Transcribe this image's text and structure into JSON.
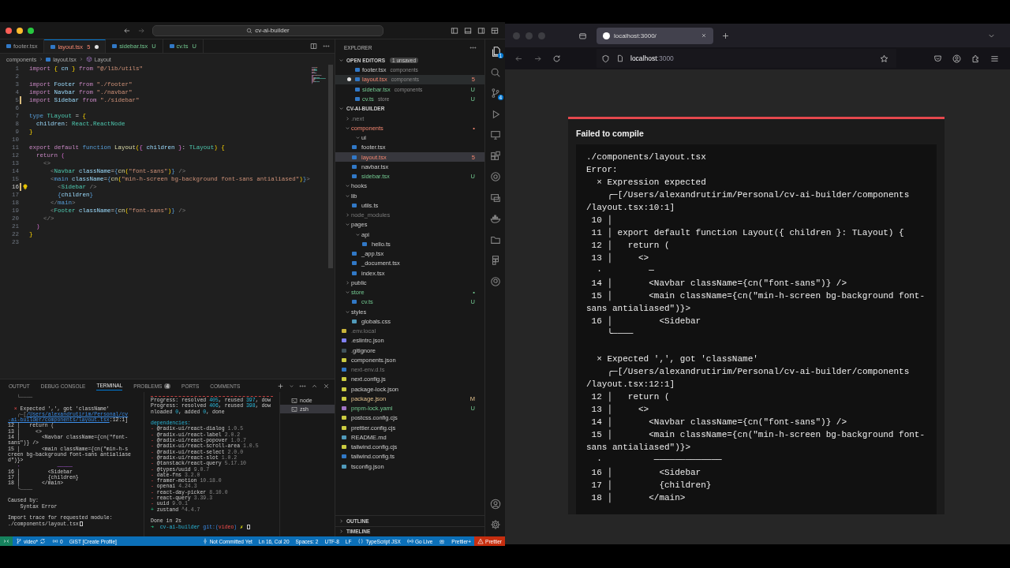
{
  "editor": {
    "title": "cv-ai-builder",
    "tabs": [
      {
        "label": "footer.tsx",
        "error": false,
        "untracked": false,
        "selected": false,
        "dirty": false
      },
      {
        "label": "layout.tsx",
        "badge": "5",
        "error": true,
        "untracked": false,
        "selected": true,
        "dirty": true
      },
      {
        "label": "sidebar.tsx",
        "badge": "U",
        "error": false,
        "untracked": true,
        "selected": false,
        "dirty": false
      },
      {
        "label": "cv.ts",
        "badge": "U",
        "error": false,
        "untracked": true,
        "selected": false,
        "dirty": false
      }
    ],
    "breadcrumb": [
      {
        "label": "components",
        "kind": "folder"
      },
      {
        "label": "layout.tsx",
        "kind": "file"
      },
      {
        "label": "Layout",
        "kind": "symbol"
      }
    ],
    "code": [
      {
        "n": "1",
        "kind": "plain",
        "tokens": [
          {
            "text": "import ",
            "kind": "keyword"
          },
          {
            "text": "{ ",
            "kind": "bracket"
          },
          {
            "text": "cn ",
            "kind": "variable"
          },
          {
            "text": "} ",
            "kind": "bracket"
          },
          {
            "text": "from ",
            "kind": "keyword"
          },
          {
            "text": "\"@/lib/utils\"",
            "kind": "string"
          }
        ]
      },
      {
        "n": "2",
        "kind": "plain"
      },
      {
        "n": "3",
        "kind": "plain",
        "tokens": [
          {
            "text": "import ",
            "kind": "keyword"
          },
          {
            "text": "Footer ",
            "kind": "variable"
          },
          {
            "text": "from ",
            "kind": "keyword"
          },
          {
            "text": "\"./footer\"",
            "kind": "string"
          }
        ]
      },
      {
        "n": "4",
        "kind": "plain",
        "tokens": [
          {
            "text": "import ",
            "kind": "keyword"
          },
          {
            "text": "Navbar ",
            "kind": "variable"
          },
          {
            "text": "from ",
            "kind": "keyword"
          },
          {
            "text": "\"./navbar\"",
            "kind": "string"
          }
        ]
      },
      {
        "n": "5",
        "kind": "changed",
        "tokens": [
          {
            "text": "import ",
            "kind": "keyword"
          },
          {
            "text": "Sidebar ",
            "kind": "variable"
          },
          {
            "text": "from ",
            "kind": "keyword"
          },
          {
            "text": "\"./sidebar\"",
            "kind": "string"
          }
        ]
      },
      {
        "n": "6",
        "kind": "plain"
      },
      {
        "n": "7",
        "kind": "plain",
        "tokens": [
          {
            "text": "type ",
            "kind": "storage"
          },
          {
            "text": "TLayout ",
            "kind": "type"
          },
          {
            "text": "= ",
            "kind": "plain"
          },
          {
            "text": "{",
            "kind": "bracket"
          }
        ]
      },
      {
        "n": "8",
        "kind": "plain",
        "tokens": [
          {
            "text": "  children",
            "kind": "variable"
          },
          {
            "text": ": ",
            "kind": "plain"
          },
          {
            "text": "React",
            "kind": "type"
          },
          {
            "text": ".",
            "kind": "plain"
          },
          {
            "text": "ReactNode",
            "kind": "type"
          }
        ]
      },
      {
        "n": "9",
        "kind": "plain",
        "tokens": [
          {
            "text": "}",
            "kind": "bracket"
          }
        ]
      },
      {
        "n": "10",
        "kind": "plain"
      },
      {
        "n": "11",
        "kind": "plain",
        "tokens": [
          {
            "text": "export default ",
            "kind": "keyword"
          },
          {
            "text": "function ",
            "kind": "storage"
          },
          {
            "text": "Layout",
            "kind": "function"
          },
          {
            "text": "(",
            "kind": "bracket"
          },
          {
            "text": "{ ",
            "kind": "bracket2"
          },
          {
            "text": "children ",
            "kind": "variable"
          },
          {
            "text": "}",
            "kind": "bracket2"
          },
          {
            "text": ": ",
            "kind": "plain"
          },
          {
            "text": "TLayout",
            "kind": "type"
          },
          {
            "text": ") ",
            "kind": "bracket"
          },
          {
            "text": "{",
            "kind": "bracket"
          }
        ]
      },
      {
        "n": "12",
        "kind": "plain",
        "tokens": [
          {
            "text": "  return ",
            "kind": "keyword"
          },
          {
            "text": "(",
            "kind": "bracket2"
          }
        ]
      },
      {
        "n": "13",
        "kind": "plain",
        "tokens": [
          {
            "text": "    <>",
            "kind": "punct"
          }
        ]
      },
      {
        "n": "14",
        "kind": "plain",
        "tokens": [
          {
            "text": "      <",
            "kind": "punct"
          },
          {
            "text": "Navbar ",
            "kind": "type"
          },
          {
            "text": "className",
            "kind": "variable"
          },
          {
            "text": "=",
            "kind": "plain"
          },
          {
            "text": "{",
            "kind": "storage"
          },
          {
            "text": "cn",
            "kind": "function"
          },
          {
            "text": "(",
            "kind": "bracket"
          },
          {
            "text": "\"font-sans\"",
            "kind": "string"
          },
          {
            "text": ")",
            "kind": "bracket"
          },
          {
            "text": "}",
            "kind": "storage"
          },
          {
            "text": " />",
            "kind": "punct"
          }
        ]
      },
      {
        "n": "15",
        "kind": "plain",
        "tokens": [
          {
            "text": "      <",
            "kind": "punct"
          },
          {
            "text": "main ",
            "kind": "storage"
          },
          {
            "text": "className",
            "kind": "variable"
          },
          {
            "text": "=",
            "kind": "plain"
          },
          {
            "text": "{",
            "kind": "storage"
          },
          {
            "text": "cn",
            "kind": "function"
          },
          {
            "text": "(",
            "kind": "bracket"
          },
          {
            "text": "\"min-h-screen bg-background font-sans antialiased\"",
            "kind": "string"
          },
          {
            "text": ")",
            "kind": "bracket"
          },
          {
            "text": "}",
            "kind": "storage"
          },
          {
            "text": ">",
            "kind": "punct"
          }
        ]
      },
      {
        "n": "16",
        "kind": "current",
        "tokens": [
          {
            "text": "        <",
            "kind": "punct"
          },
          {
            "text": "Sidebar ",
            "kind": "type"
          },
          {
            "text": "/>",
            "kind": "punct"
          }
        ]
      },
      {
        "n": "17",
        "kind": "plain",
        "tokens": [
          {
            "text": "        {",
            "kind": "storage"
          },
          {
            "text": "children",
            "kind": "variable"
          },
          {
            "text": "}",
            "kind": "storage"
          }
        ]
      },
      {
        "n": "18",
        "kind": "plain",
        "tokens": [
          {
            "text": "      </",
            "kind": "punct"
          },
          {
            "text": "main",
            "kind": "storage"
          },
          {
            "text": ">",
            "kind": "punct"
          }
        ]
      },
      {
        "n": "19",
        "kind": "plain",
        "tokens": [
          {
            "text": "      <",
            "kind": "punct"
          },
          {
            "text": "Footer ",
            "kind": "type"
          },
          {
            "text": "className",
            "kind": "variable"
          },
          {
            "text": "=",
            "kind": "plain"
          },
          {
            "text": "{",
            "kind": "storage"
          },
          {
            "text": "cn",
            "kind": "function"
          },
          {
            "text": "(",
            "kind": "bracket"
          },
          {
            "text": "\"font-sans\"",
            "kind": "string"
          },
          {
            "text": ")",
            "kind": "bracket"
          },
          {
            "text": "}",
            "kind": "storage"
          },
          {
            "text": " />",
            "kind": "punct"
          }
        ]
      },
      {
        "n": "20",
        "kind": "plain",
        "tokens": [
          {
            "text": "    </>",
            "kind": "punct"
          }
        ]
      },
      {
        "n": "21",
        "kind": "plain",
        "tokens": [
          {
            "text": "  )",
            "kind": "bracket2"
          }
        ]
      },
      {
        "n": "22",
        "kind": "plain",
        "tokens": [
          {
            "text": "}",
            "kind": "bracket"
          }
        ]
      },
      {
        "n": "23",
        "kind": "plain"
      }
    ],
    "panel_tabs": [
      {
        "label": "OUTPUT",
        "selected": false
      },
      {
        "label": "DEBUG CONSOLE",
        "selected": false
      },
      {
        "label": "TERMINAL",
        "selected": true
      },
      {
        "label": "PROBLEMS",
        "badge": "4",
        "selected": false
      },
      {
        "label": "PORTS",
        "selected": false
      },
      {
        "label": "COMMENTS",
        "selected": false
      }
    ],
    "terminal_left": {
      "cursor": true,
      "blocks": [
        [
          [
            {
              "text": "   └────",
              "kind": "dim"
            }
          ]
        ],
        [
          [
            {
              "text": "  × ",
              "kind": "error"
            },
            {
              "text": "Expected ',', got 'className'",
              "kind": "text"
            }
          ],
          [
            {
              "text": "   ╭─[",
              "kind": "dim"
            },
            {
              "text": "/Users/alexandrutirim/Personal/cv",
              "kind": "link"
            }
          ],
          [
            {
              "text": "-ai-builder/components/layout.tsx",
              "kind": "link"
            },
            {
              "text": ":12:1]",
              "kind": "text"
            }
          ],
          [
            {
              "text": "12 │   return (",
              "kind": "text"
            }
          ],
          [
            {
              "text": "13 │     <>",
              "kind": "text"
            }
          ],
          [
            {
              "text": "14 │       <Navbar className={cn(\"font-",
              "kind": "text"
            }
          ],
          [
            {
              "text": "sans\")} />",
              "kind": "text"
            }
          ],
          [
            {
              "text": "15 │       <main className={cn(\"min-h-s",
              "kind": "text"
            }
          ],
          [
            {
              "text": "creen bg-background font-sans antialiase",
              "kind": "text"
            }
          ],
          [
            {
              "text": "d\")}>",
              "kind": "text"
            }
          ],
          [
            {
              "text": "   ·            ─────",
              "kind": "mark"
            }
          ],
          [
            {
              "text": "16 │         <Sidebar",
              "kind": "text"
            }
          ],
          [
            {
              "text": "17 │         {children}",
              "kind": "text"
            }
          ],
          [
            {
              "text": "18 │       </main>",
              "kind": "text"
            }
          ],
          [
            {
              "text": "   ╰────",
              "kind": "dim"
            }
          ]
        ],
        [
          [
            {
              "text": "Caused by:",
              "kind": "text"
            }
          ],
          [
            {
              "text": "    Syntax Error",
              "kind": "text"
            }
          ]
        ],
        [
          [
            {
              "text": "Import trace for requested module:",
              "kind": "text"
            }
          ],
          [
            {
              "text": "./components/layout.tsx",
              "kind": "text"
            }
          ]
        ]
      ]
    },
    "terminal_right": {
      "cursor": true,
      "blocks": [
        [
          [
            {
              "text": "Progress: resolved ",
              "kind": "text"
            },
            {
              "text": "405",
              "kind": "number"
            },
            {
              "text": ", reused ",
              "kind": "text"
            },
            {
              "text": "397",
              "kind": "number"
            },
            {
              "text": ", dow",
              "kind": "text"
            }
          ],
          [
            {
              "text": "Progress: resolved ",
              "kind": "text"
            },
            {
              "text": "406",
              "kind": "number"
            },
            {
              "text": ", reused ",
              "kind": "text"
            },
            {
              "text": "398",
              "kind": "number"
            },
            {
              "text": ", dow",
              "kind": "text"
            }
          ],
          [
            {
              "text": "nloaded ",
              "kind": "text"
            },
            {
              "text": "0",
              "kind": "number"
            },
            {
              "text": ", added ",
              "kind": "text"
            },
            {
              "text": "0",
              "kind": "number"
            },
            {
              "text": ", done",
              "kind": "text"
            }
          ]
        ],
        [
          [
            {
              "text": "dependencies:",
              "kind": "heading"
            }
          ],
          [
            {
              "text": "- ",
              "kind": "error"
            },
            {
              "text": "@radix-ui/react-dialog ",
              "kind": "text"
            },
            {
              "text": "1.0.5",
              "kind": "dim"
            }
          ],
          [
            {
              "text": "- ",
              "kind": "error"
            },
            {
              "text": "@radix-ui/react-label ",
              "kind": "text"
            },
            {
              "text": "2.0.2",
              "kind": "dim"
            }
          ],
          [
            {
              "text": "- ",
              "kind": "error"
            },
            {
              "text": "@radix-ui/react-popover ",
              "kind": "text"
            },
            {
              "text": "1.0.7",
              "kind": "dim"
            }
          ],
          [
            {
              "text": "- ",
              "kind": "error"
            },
            {
              "text": "@radix-ui/react-scroll-area ",
              "kind": "text"
            },
            {
              "text": "1.0.5",
              "kind": "dim"
            }
          ],
          [
            {
              "text": "- ",
              "kind": "error"
            },
            {
              "text": "@radix-ui/react-select ",
              "kind": "text"
            },
            {
              "text": "2.0.0",
              "kind": "dim"
            }
          ],
          [
            {
              "text": "- ",
              "kind": "error"
            },
            {
              "text": "@radix-ui/react-slot ",
              "kind": "text"
            },
            {
              "text": "1.0.2",
              "kind": "dim"
            }
          ],
          [
            {
              "text": "- ",
              "kind": "error"
            },
            {
              "text": "@tanstack/react-query ",
              "kind": "text"
            },
            {
              "text": "5.17.10",
              "kind": "dim"
            }
          ],
          [
            {
              "text": "- ",
              "kind": "error"
            },
            {
              "text": "@types/uuid ",
              "kind": "text"
            },
            {
              "text": "9.0.7",
              "kind": "dim"
            }
          ],
          [
            {
              "text": "- ",
              "kind": "error"
            },
            {
              "text": "date-fns ",
              "kind": "text"
            },
            {
              "text": "3.2.0",
              "kind": "dim"
            }
          ],
          [
            {
              "text": "- ",
              "kind": "error"
            },
            {
              "text": "framer-motion ",
              "kind": "text"
            },
            {
              "text": "10.18.0",
              "kind": "dim"
            }
          ],
          [
            {
              "text": "- ",
              "kind": "error"
            },
            {
              "text": "openai ",
              "kind": "text"
            },
            {
              "text": "4.24.3",
              "kind": "dim"
            }
          ],
          [
            {
              "text": "- ",
              "kind": "error"
            },
            {
              "text": "react-day-picker ",
              "kind": "text"
            },
            {
              "text": "8.10.0",
              "kind": "dim"
            }
          ],
          [
            {
              "text": "- ",
              "kind": "error"
            },
            {
              "text": "react-query ",
              "kind": "text"
            },
            {
              "text": "3.39.3",
              "kind": "dim"
            }
          ],
          [
            {
              "text": "- ",
              "kind": "error"
            },
            {
              "text": "uuid ",
              "kind": "text"
            },
            {
              "text": "9.0.1",
              "kind": "dim"
            }
          ],
          [
            {
              "text": "+ ",
              "kind": "ok"
            },
            {
              "text": "zustand ",
              "kind": "text"
            },
            {
              "text": "^4.4.7",
              "kind": "dim"
            }
          ]
        ],
        [
          [
            {
              "text": "Done in 2s",
              "kind": "text"
            }
          ],
          [
            {
              "text": "➜  ",
              "kind": "ok"
            },
            {
              "text": "cv-ai-builder ",
              "kind": "heading"
            },
            {
              "text": "git:(",
              "kind": "git"
            },
            {
              "text": "video",
              "kind": "error"
            },
            {
              "text": ") ",
              "kind": "git"
            },
            {
              "text": "✗ ",
              "kind": "warn"
            }
          ]
        ]
      ]
    },
    "terminals": [
      {
        "label": "node",
        "selected": false
      },
      {
        "label": "zsh",
        "selected": true
      }
    ],
    "explorer": {
      "title": "EXPLORER",
      "open_editors": {
        "title": "OPEN EDITORS",
        "badge": "1 unsaved",
        "items": [
          {
            "label": "footer.tsx",
            "folder": "components",
            "kind": "ts",
            "error": false,
            "untracked": false,
            "selected": false,
            "dirty": false
          },
          {
            "label": "layout.tsx",
            "folder": "components",
            "kind": "ts",
            "badge": "5",
            "error": true,
            "untracked": false,
            "selected": true,
            "dirty": true
          },
          {
            "label": "sidebar.tsx",
            "folder": "components",
            "kind": "ts",
            "badge": "U",
            "error": false,
            "untracked": true,
            "selected": false,
            "dirty": false
          },
          {
            "label": "cv.ts",
            "folder": "store",
            "kind": "ts",
            "badge": "U",
            "error": false,
            "untracked": true,
            "selected": false,
            "dirty": false
          }
        ]
      },
      "project": "CV-AI-BUILDER",
      "tree": [
        {
          "label": ".next",
          "kind": "folder",
          "expanded": false,
          "selected": false,
          "error": false,
          "untracked": false,
          "modified": false,
          "ignored": true
        },
        {
          "label": "components",
          "kind": "folder",
          "badge": "•",
          "expanded": true,
          "selected": false,
          "error": true,
          "untracked": false,
          "modified": false,
          "ignored": false,
          "children": [
            {
              "label": "ui",
              "kind": "folder",
              "expanded": true,
              "selected": false,
              "error": false,
              "untracked": false,
              "modified": false,
              "ignored": false
            },
            {
              "label": "footer.tsx",
              "kind": "ts",
              "selected": false,
              "error": false,
              "untracked": false,
              "modified": false,
              "ignored": false
            },
            {
              "label": "layout.tsx",
              "kind": "ts",
              "badge": "5",
              "selected": true,
              "error": true,
              "untracked": false,
              "modified": false,
              "ignored": false
            },
            {
              "label": "navbar.tsx",
              "kind": "ts",
              "selected": false,
              "error": false,
              "untracked": false,
              "modified": false,
              "ignored": false
            },
            {
              "label": "sidebar.tsx",
              "kind": "ts",
              "badge": "U",
              "selected": false,
              "error": false,
              "untracked": true,
              "modified": false,
              "ignored": false
            }
          ]
        },
        {
          "label": "hooks",
          "kind": "folder",
          "expanded": true,
          "selected": false,
          "error": false,
          "untracked": false,
          "modified": false,
          "ignored": false
        },
        {
          "label": "lib",
          "kind": "folder",
          "expanded": true,
          "selected": false,
          "error": false,
          "untracked": false,
          "modified": false,
          "ignored": false,
          "children": [
            {
              "label": "utils.ts",
              "kind": "ts",
              "selected": false,
              "error": false,
              "untracked": false,
              "modified": false,
              "ignored": false
            }
          ]
        },
        {
          "label": "node_modules",
          "kind": "folder",
          "expanded": false,
          "selected": false,
          "error": false,
          "untracked": false,
          "modified": false,
          "ignored": true
        },
        {
          "label": "pages",
          "kind": "folder",
          "expanded": true,
          "selected": false,
          "error": false,
          "untracked": false,
          "modified": false,
          "ignored": false,
          "children": [
            {
              "label": "api",
              "kind": "folder",
              "expanded": true,
              "selected": false,
              "error": false,
              "untracked": false,
              "modified": false,
              "ignored": false,
              "children": [
                {
                  "label": "hello.ts",
                  "kind": "ts",
                  "selected": false,
                  "error": false,
                  "untracked": false,
                  "modified": false,
                  "ignored": false
                }
              ]
            },
            {
              "label": "_app.tsx",
              "kind": "ts",
              "selected": false,
              "error": false,
              "untracked": false,
              "modified": false,
              "ignored": false
            },
            {
              "label": "_document.tsx",
              "kind": "ts",
              "selected": false,
              "error": false,
              "untracked": false,
              "modified": false,
              "ignored": false
            },
            {
              "label": "index.tsx",
              "kind": "ts",
              "selected": false,
              "error": false,
              "untracked": false,
              "modified": false,
              "ignored": false
            }
          ]
        },
        {
          "label": "public",
          "kind": "folder",
          "expanded": false,
          "selected": false,
          "error": false,
          "untracked": false,
          "modified": false,
          "ignored": false
        },
        {
          "label": "store",
          "kind": "folder",
          "badge": "•",
          "expanded": true,
          "selected": false,
          "error": false,
          "untracked": true,
          "modified": false,
          "ignored": false,
          "children": [
            {
              "label": "cv.ts",
              "kind": "ts",
              "badge": "U",
              "selected": false,
              "error": false,
              "untracked": true,
              "modified": false,
              "ignored": false
            }
          ]
        },
        {
          "label": "styles",
          "kind": "folder",
          "expanded": true,
          "selected": false,
          "error": false,
          "untracked": false,
          "modified": false,
          "ignored": false,
          "children": [
            {
              "label": "globals.css",
              "kind": "css",
              "selected": false,
              "error": false,
              "untracked": false,
              "modified": false,
              "ignored": false
            }
          ]
        },
        {
          "label": ".env.local",
          "kind": "env",
          "selected": false,
          "error": false,
          "untracked": false,
          "modified": false,
          "ignored": true
        },
        {
          "label": ".eslintrc.json",
          "kind": "eslint",
          "selected": false,
          "error": false,
          "untracked": false,
          "modified": false,
          "ignored": false
        },
        {
          "label": ".gitignore",
          "kind": "git",
          "selected": false,
          "error": false,
          "untracked": false,
          "modified": false,
          "ignored": false
        },
        {
          "label": "components.json",
          "kind": "json",
          "selected": false,
          "error": false,
          "untracked": false,
          "modified": false,
          "ignored": false
        },
        {
          "label": "next-env.d.ts",
          "kind": "ts",
          "selected": false,
          "error": false,
          "untracked": false,
          "modified": false,
          "ignored": true
        },
        {
          "label": "next.config.js",
          "kind": "js",
          "selected": false,
          "error": false,
          "untracked": false,
          "modified": false,
          "ignored": false
        },
        {
          "label": "package-lock.json",
          "kind": "json",
          "selected": false,
          "error": false,
          "untracked": false,
          "modified": false,
          "ignored": false
        },
        {
          "label": "package.json",
          "kind": "json",
          "badge": "M",
          "selected": false,
          "error": false,
          "untracked": false,
          "modified": true,
          "ignored": false
        },
        {
          "label": "pnpm-lock.yaml",
          "kind": "yaml",
          "badge": "U",
          "selected": false,
          "error": false,
          "untracked": true,
          "modified": false,
          "ignored": false
        },
        {
          "label": "postcss.config.cjs",
          "kind": "js",
          "selected": false,
          "error": false,
          "untracked": false,
          "modified": false,
          "ignored": false
        },
        {
          "label": "prettier.config.cjs",
          "kind": "js",
          "selected": false,
          "error": false,
          "untracked": false,
          "modified": false,
          "ignored": false
        },
        {
          "label": "README.md",
          "kind": "info",
          "selected": false,
          "error": false,
          "untracked": false,
          "modified": false,
          "ignored": false
        },
        {
          "label": "tailwind.config.cjs",
          "kind": "js",
          "selected": false,
          "error": false,
          "untracked": false,
          "modified": false,
          "ignored": false
        },
        {
          "label": "tailwind.config.ts",
          "kind": "ts",
          "selected": false,
          "error": false,
          "untracked": false,
          "modified": false,
          "ignored": false
        },
        {
          "label": "tsconfig.json",
          "kind": "tsconfig",
          "selected": false,
          "error": false,
          "untracked": false,
          "modified": false,
          "ignored": false
        }
      ],
      "sections": [
        "OUTLINE",
        "TIMELINE"
      ]
    },
    "activity_bar": [
      {
        "kind": "files",
        "badge": "1",
        "selected": true
      },
      {
        "kind": "search",
        "selected": false
      },
      {
        "kind": "source-control",
        "badge": "4",
        "selected": false
      },
      {
        "kind": "run",
        "selected": false
      },
      {
        "kind": "remote",
        "selected": false
      },
      {
        "kind": "extensions",
        "selected": false
      },
      {
        "kind": "target",
        "selected": false
      },
      {
        "kind": "screens",
        "selected": false
      },
      {
        "kind": "whale",
        "selected": false
      },
      {
        "kind": "folder",
        "selected": false
      },
      {
        "kind": "grid",
        "selected": false
      },
      {
        "kind": "circle",
        "selected": false
      }
    ],
    "status_bar": [
      {
        "kind": "branch",
        "text": "video*"
      },
      {
        "kind": "ports",
        "text": "0"
      },
      {
        "kind": "plain",
        "text": "GIST [Create Profile]"
      },
      {
        "kind": "commit",
        "text": "Not Committed Yet"
      },
      {
        "kind": "plain",
        "text": "Ln 16, Col 20"
      },
      {
        "kind": "plain",
        "text": "Spaces: 2"
      },
      {
        "kind": "plain",
        "text": "UTF-8"
      },
      {
        "kind": "plain",
        "text": "LF"
      },
      {
        "kind": "braces",
        "text": "TypeScript JSX"
      },
      {
        "kind": "golive",
        "text": "Go Live"
      },
      {
        "kind": "copilot"
      },
      {
        "kind": "plain",
        "text": "Prettier+"
      },
      {
        "kind": "error",
        "text": "Prettier"
      }
    ]
  },
  "browser": {
    "tab": {
      "title": "localhost:3000/",
      "selected": true
    },
    "url": {
      "host": "localhost",
      "port": ":3000"
    },
    "overlay": {
      "title": "Failed to compile",
      "header": [
        "./components/layout.tsx",
        "Error:"
      ],
      "errors": [
        [
          "  × Expression expected",
          "    ╭─[/Users/alexandrutirim/Personal/cv-ai-builder/components",
          "/layout.tsx:10:1]",
          " 10 │",
          " 11 │ export default function Layout({ children }: TLayout) {",
          " 12 │   return (",
          " 13 │     <>",
          "  ·         ─",
          " 14 │       <Navbar className={cn(\"font-sans\")} />",
          " 15 │       <main className={cn(\"min-h-screen bg-background font-",
          "sans antialiased\")}>",
          " 16 │         <Sidebar",
          "    ╰────"
        ],
        [
          "  × Expected ',', got 'className'",
          "    ╭─[/Users/alexandrutirim/Personal/cv-ai-builder/components",
          "/layout.tsx:12:1]",
          " 12 │   return (",
          " 13 │     <>",
          " 14 │       <Navbar className={cn(\"font-sans\")} />",
          " 15 │       <main className={cn(\"min-h-screen bg-background font-",
          "sans antialiased\")}>",
          "  ·          ─────────────",
          " 16 │         <Sidebar",
          " 17 │         {children}",
          " 18 │       </main>"
        ]
      ]
    }
  }
}
